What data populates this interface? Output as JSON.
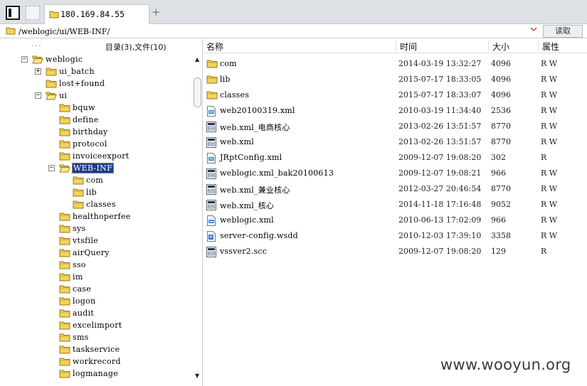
{
  "tabs": {
    "active_label": "180.169.84.55",
    "new_tab_symbol": "+"
  },
  "address": {
    "path": "/weblogic/ui/WEB-INF/",
    "read_button": "读取"
  },
  "tree": {
    "ellipsis": "...",
    "summary": "目录(3),文件(10)",
    "items": [
      {
        "label": "weblogic",
        "level": 0,
        "toggle": "−",
        "selected": false,
        "open": true
      },
      {
        "label": "ui_batch",
        "level": 1,
        "toggle": "+",
        "selected": false,
        "open": false
      },
      {
        "label": "lost+found",
        "level": 1,
        "toggle": "",
        "selected": false,
        "open": false
      },
      {
        "label": "ui",
        "level": 1,
        "toggle": "−",
        "selected": false,
        "open": true
      },
      {
        "label": "bquw",
        "level": 2,
        "toggle": "",
        "selected": false,
        "open": false
      },
      {
        "label": "define",
        "level": 2,
        "toggle": "",
        "selected": false,
        "open": false
      },
      {
        "label": "birthday",
        "level": 2,
        "toggle": "",
        "selected": false,
        "open": false
      },
      {
        "label": "protocol",
        "level": 2,
        "toggle": "",
        "selected": false,
        "open": false
      },
      {
        "label": "invoiceexport",
        "level": 2,
        "toggle": "",
        "selected": false,
        "open": false
      },
      {
        "label": "WEB-INF",
        "level": 2,
        "toggle": "−",
        "selected": true,
        "open": true
      },
      {
        "label": "com",
        "level": 3,
        "toggle": "",
        "selected": false,
        "open": false
      },
      {
        "label": "lib",
        "level": 3,
        "toggle": "",
        "selected": false,
        "open": false
      },
      {
        "label": "classes",
        "level": 3,
        "toggle": "",
        "selected": false,
        "open": false
      },
      {
        "label": "healthoperfee",
        "level": 2,
        "toggle": "",
        "selected": false,
        "open": false
      },
      {
        "label": "sys",
        "level": 2,
        "toggle": "",
        "selected": false,
        "open": false
      },
      {
        "label": "vtsfile",
        "level": 2,
        "toggle": "",
        "selected": false,
        "open": false
      },
      {
        "label": "airQuery",
        "level": 2,
        "toggle": "",
        "selected": false,
        "open": false
      },
      {
        "label": "sso",
        "level": 2,
        "toggle": "",
        "selected": false,
        "open": false
      },
      {
        "label": "im",
        "level": 2,
        "toggle": "",
        "selected": false,
        "open": false
      },
      {
        "label": "case",
        "level": 2,
        "toggle": "",
        "selected": false,
        "open": false
      },
      {
        "label": "logon",
        "level": 2,
        "toggle": "",
        "selected": false,
        "open": false
      },
      {
        "label": "audit",
        "level": 2,
        "toggle": "",
        "selected": false,
        "open": false
      },
      {
        "label": "excelimport",
        "level": 2,
        "toggle": "",
        "selected": false,
        "open": false
      },
      {
        "label": "sms",
        "level": 2,
        "toggle": "",
        "selected": false,
        "open": false
      },
      {
        "label": "taskservice",
        "level": 2,
        "toggle": "",
        "selected": false,
        "open": false
      },
      {
        "label": "workrecord",
        "level": 2,
        "toggle": "",
        "selected": false,
        "open": false
      },
      {
        "label": "logmanage",
        "level": 2,
        "toggle": "",
        "selected": false,
        "open": false
      }
    ]
  },
  "file_list": {
    "columns": {
      "name": "名称",
      "time": "时间",
      "size": "大小",
      "attr": "属性"
    },
    "rows": [
      {
        "icon": "folder-icon",
        "name": "com",
        "time": "2014-03-19 13:32:27",
        "size": "4096",
        "attr": "R W"
      },
      {
        "icon": "folder-icon",
        "name": "lib",
        "time": "2015-07-17 18:33:05",
        "size": "4096",
        "attr": "R W"
      },
      {
        "icon": "folder-icon",
        "name": "classes",
        "time": "2015-07-17 18:33:07",
        "size": "4096",
        "attr": "R W"
      },
      {
        "icon": "xml-file-icon",
        "name": "web20100319.xml",
        "time": "2010-03-19 11:34:40",
        "size": "2536",
        "attr": "R W"
      },
      {
        "icon": "generic-file-icon",
        "name": "web.xml_电商核心",
        "time": "2013-02-26 13:51:57",
        "size": "8770",
        "attr": "R W"
      },
      {
        "icon": "generic-file-icon",
        "name": "web.xml",
        "time": "2013-02-26 13:51:57",
        "size": "8770",
        "attr": "R W"
      },
      {
        "icon": "xml-file-icon",
        "name": "JRptConfig.xml",
        "time": "2009-12-07 19:08:20",
        "size": "302",
        "attr": "R"
      },
      {
        "icon": "generic-file-icon",
        "name": "weblogic.xml_bak20100613",
        "time": "2009-12-07 19:08:21",
        "size": "966",
        "attr": "R W"
      },
      {
        "icon": "generic-file-icon",
        "name": "web.xml_兼业核心",
        "time": "2012-03-27 20:46:54",
        "size": "8770",
        "attr": "R W"
      },
      {
        "icon": "generic-file-icon",
        "name": "web.xml_核心",
        "time": "2014-11-18 17:16:48",
        "size": "9052",
        "attr": "R W"
      },
      {
        "icon": "xml-file-icon",
        "name": "weblogic.xml",
        "time": "2010-06-13 17:02:09",
        "size": "966",
        "attr": "R W"
      },
      {
        "icon": "wsdd-file-icon",
        "name": "server-config.wsdd",
        "time": "2010-12-03 17:39:10",
        "size": "3358",
        "attr": "R W"
      },
      {
        "icon": "generic-file-icon",
        "name": "vssver2.scc",
        "time": "2009-12-07 19:08:20",
        "size": "129",
        "attr": "R"
      }
    ]
  },
  "watermark": "www.wooyun.org",
  "colors": {
    "folder": "#f3d35a",
    "selection": "#1c3c8c",
    "tabbar": "#dde1e6"
  }
}
